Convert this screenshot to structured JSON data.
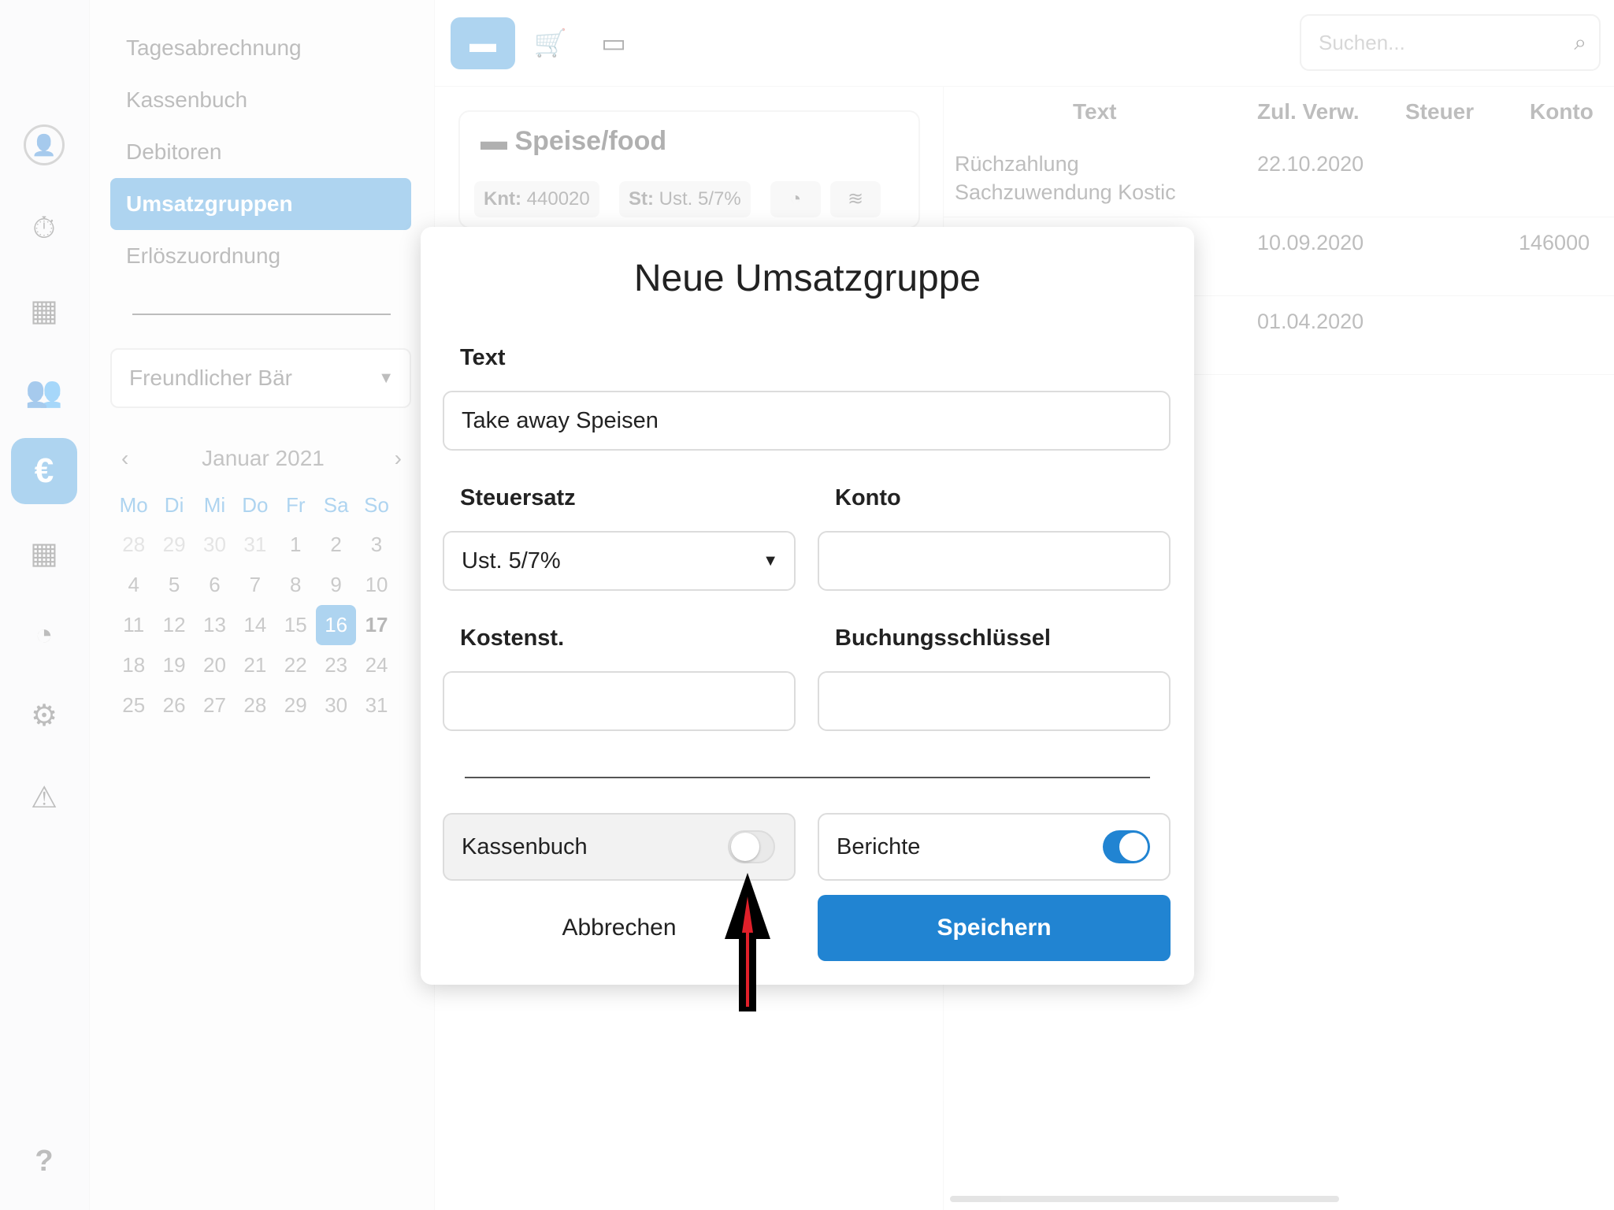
{
  "rail": {
    "items": [
      {
        "name": "profile-icon",
        "glyph": "●"
      },
      {
        "name": "stopwatch-icon",
        "glyph": "⏱"
      },
      {
        "name": "table-icon",
        "glyph": "▦"
      },
      {
        "name": "users-icon",
        "glyph": "👥"
      },
      {
        "name": "euro-icon",
        "glyph": "€"
      },
      {
        "name": "calendar-icon",
        "glyph": "▦"
      },
      {
        "name": "pie-chart-icon",
        "glyph": "◔"
      },
      {
        "name": "gear-icon",
        "glyph": "⚙"
      },
      {
        "name": "warning-icon",
        "glyph": "⚠"
      },
      {
        "name": "help-icon",
        "glyph": "?"
      }
    ]
  },
  "subnav": {
    "items": [
      {
        "label": "Tagesabrechnung"
      },
      {
        "label": "Kassenbuch"
      },
      {
        "label": "Debitoren"
      },
      {
        "label": "Umsatzgruppen"
      },
      {
        "label": "Erlöszuordnung"
      }
    ],
    "venue": "Freundlicher Bär"
  },
  "calendar": {
    "month_label": "Januar 2021",
    "weekdays": [
      "Mo",
      "Di",
      "Mi",
      "Do",
      "Fr",
      "Sa",
      "So"
    ],
    "days": [
      "28",
      "29",
      "30",
      "31",
      "1",
      "2",
      "3",
      "4",
      "5",
      "6",
      "7",
      "8",
      "9",
      "10",
      "11",
      "12",
      "13",
      "14",
      "15",
      "16",
      "17",
      "18",
      "19",
      "20",
      "21",
      "22",
      "23",
      "24",
      "25",
      "26",
      "27",
      "28",
      "29",
      "30",
      "31"
    ],
    "today": "16"
  },
  "toolbar": {
    "search_placeholder": "Suchen..."
  },
  "card": {
    "title": "Speise/food",
    "konto_label": "Knt:",
    "konto_value": "440020",
    "steuer_label": "St:",
    "steuer_value": "Ust. 5/7%"
  },
  "table": {
    "headers": {
      "text": "Text",
      "date": "Zul. Verw.",
      "tax": "Steuer",
      "account": "Konto"
    },
    "rows": [
      {
        "text_line1": "Rüchzahlung",
        "text_line2": "Sachzuwendung Kostic",
        "date": "22.10.2020",
        "tax": "",
        "account": ""
      },
      {
        "text_line1": "",
        "text_line2": "",
        "date": "10.09.2020",
        "tax": "",
        "account": "146000"
      },
      {
        "text_line1": "",
        "text_line2": "",
        "date": "01.04.2020",
        "tax": "",
        "account": ""
      }
    ]
  },
  "modal": {
    "title": "Neue Umsatzgruppe",
    "text_label": "Text",
    "text_value": "Take away Speisen",
    "tax_label": "Steuersatz",
    "tax_value": "Ust. 5/7%",
    "account_label": "Konto",
    "account_value": "",
    "cost_label": "Kostenst.",
    "cost_value": "",
    "booking_label": "Buchungsschlüssel",
    "booking_value": "",
    "cashbook_label": "Kassenbuch",
    "cashbook_on": false,
    "reports_label": "Berichte",
    "reports_on": true,
    "cancel_label": "Abbrechen",
    "save_label": "Speichern"
  },
  "colors": {
    "accent": "#2184d2",
    "arrow_fill": "#000000",
    "arrow_stripe": "#e0202a"
  }
}
